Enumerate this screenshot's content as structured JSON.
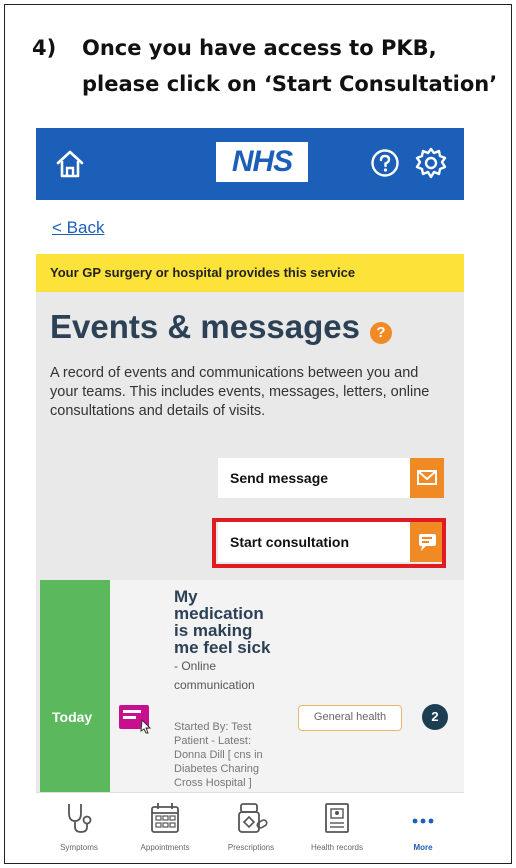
{
  "instruction": {
    "number": "4)",
    "line1": "Once you have access to PKB,",
    "line2": "please click on ‘Start Consultation’"
  },
  "header": {
    "logo_text": "NHS",
    "home_icon": "home-icon",
    "help_icon": "help-icon",
    "settings_icon": "gear-icon",
    "brand_color": "#1c5fb8"
  },
  "nav": {
    "back_label": "< Back"
  },
  "banner": {
    "text": "Your GP surgery or hospital provides this service",
    "color": "#fde23a"
  },
  "page": {
    "title": "Events & messages",
    "help_badge": "?",
    "description": "A record of events and communications between you and your teams. This includes events, messages, letters, online consultations and details of visits."
  },
  "actions": {
    "send_message": "Send message",
    "start_consultation": "Start consultation",
    "accent_color": "#f08a24",
    "highlight_color": "#e11b22"
  },
  "event": {
    "day": "Today",
    "subject": "My medication is making me feel sick",
    "type": "- Online communication",
    "meta": "Started By: Test Patient - Latest: Donna Dill [ cns in Diabetes Charing Cross Hospital ]",
    "tag": "General health",
    "count": "2"
  },
  "tabbar": {
    "items": [
      {
        "label": "Symptoms",
        "icon": "stethoscope-icon"
      },
      {
        "label": "Appointments",
        "icon": "calendar-icon"
      },
      {
        "label": "Prescriptions",
        "icon": "pills-icon"
      },
      {
        "label": "Health records",
        "icon": "records-icon"
      },
      {
        "label": "More",
        "icon": "more-icon"
      }
    ]
  }
}
